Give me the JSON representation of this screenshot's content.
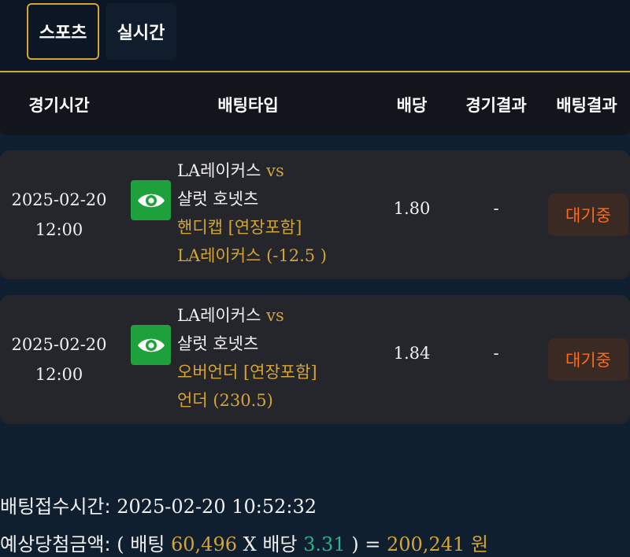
{
  "tabs": [
    {
      "label": "스포츠",
      "active": true
    },
    {
      "label": "실시간",
      "active": false
    }
  ],
  "table": {
    "headers": [
      "경기시간",
      "배팅타입",
      "배당",
      "경기결과",
      "배팅결과"
    ]
  },
  "bets": [
    {
      "date": "2025-02-20",
      "time": "12:00",
      "home": "LA레이커스",
      "vs": "vs",
      "away": "샬럿 호넷츠",
      "market": "핸디캡 [연장포함]",
      "pick": "LA레이커스 (-12.5 )",
      "odds": "1.80",
      "game_result": "-",
      "status": "대기중"
    },
    {
      "date": "2025-02-20",
      "time": "12:00",
      "home": "LA레이커스",
      "vs": "vs",
      "away": "샬럿 호넷츠",
      "market": "오버언더 [연장포함]",
      "pick": "언더 (230.5)",
      "odds": "1.84",
      "game_result": "-",
      "status": "대기중"
    }
  ],
  "summary": {
    "receipt_label": "배팅접수시간:",
    "receipt_time": "2025-02-20 10:52:32",
    "expected_label": "예상당첨금액:",
    "open_paren": "( 배팅",
    "bet_amount": "60,496",
    "times": "X 배당",
    "total_odds": "3.31",
    "close_eq": ") =",
    "payout": "200,241 원"
  },
  "colors": {
    "accent_gold": "#d4a437",
    "eye_button": "#1ea13b",
    "status_orange": "#ff6a1a",
    "odds_teal": "#2bb38c"
  },
  "icons": {
    "view": "eye-icon"
  }
}
